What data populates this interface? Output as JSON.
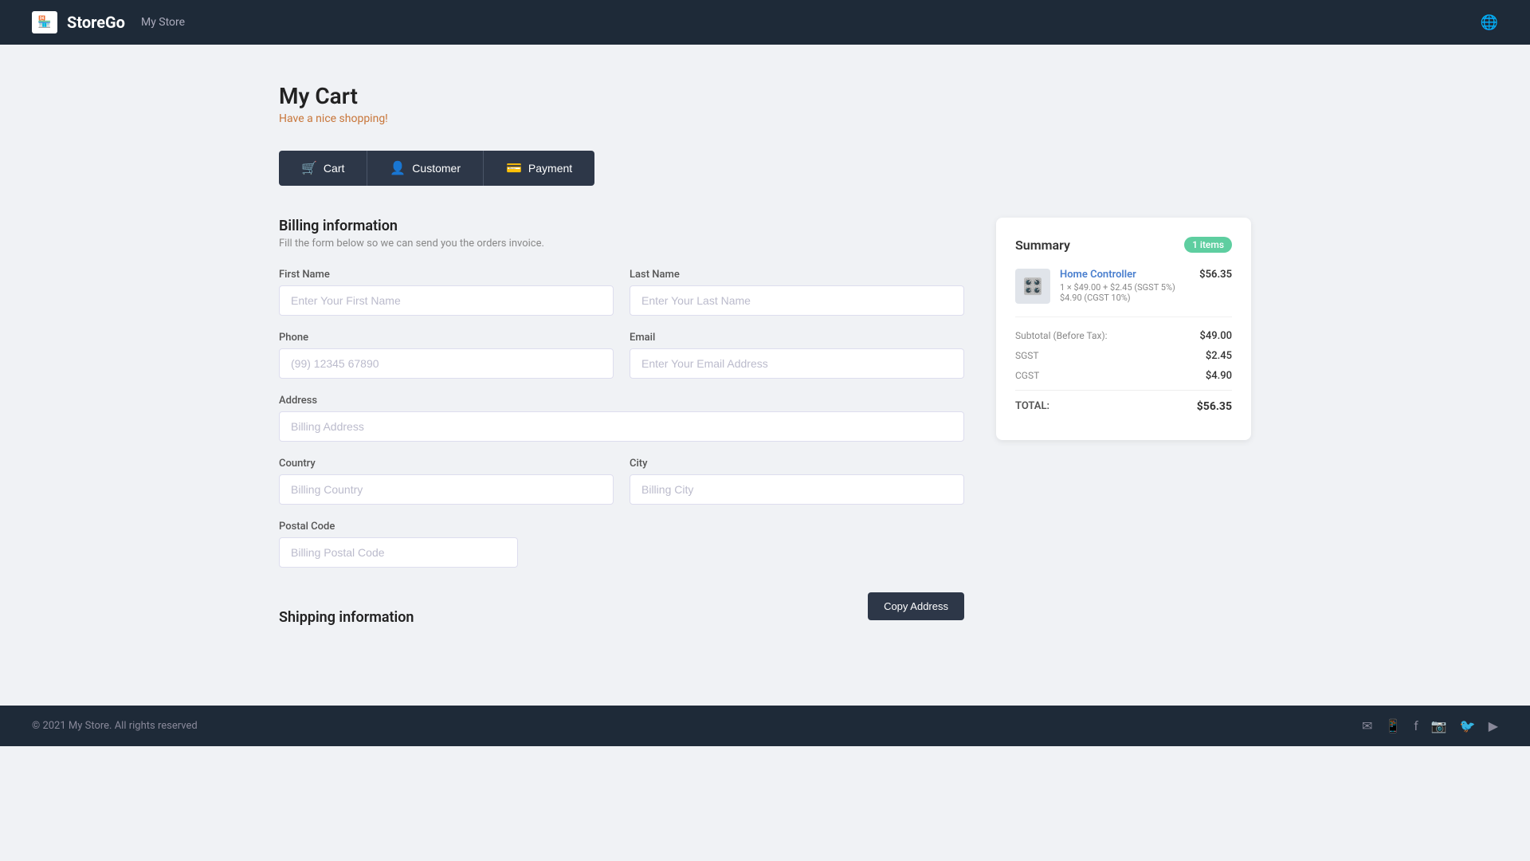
{
  "header": {
    "logo_text": "StoreGo",
    "store_name": "My Store",
    "logo_icon": "🏪"
  },
  "page": {
    "title": "My Cart",
    "subtitle": "Have a nice shopping!"
  },
  "tabs": [
    {
      "id": "cart",
      "label": "Cart",
      "icon": "🛒"
    },
    {
      "id": "customer",
      "label": "Customer",
      "icon": "👤"
    },
    {
      "id": "payment",
      "label": "Payment",
      "icon": "💳"
    }
  ],
  "billing": {
    "section_title": "Billing information",
    "section_subtitle": "Fill the form below so we can send you the orders invoice.",
    "fields": {
      "first_name_label": "First Name",
      "first_name_placeholder": "Enter Your First Name",
      "last_name_label": "Last Name",
      "last_name_placeholder": "Enter Your Last Name",
      "phone_label": "Phone",
      "phone_placeholder": "(99) 12345 67890",
      "email_label": "Email",
      "email_placeholder": "Enter Your Email Address",
      "address_label": "Address",
      "address_placeholder": "Billing Address",
      "country_label": "Country",
      "country_placeholder": "Billing Country",
      "city_label": "City",
      "city_placeholder": "Billing City",
      "postal_label": "Postal Code",
      "postal_placeholder": "Billing Postal Code"
    }
  },
  "shipping": {
    "section_title": "Shipping information",
    "copy_button_label": "Copy Address"
  },
  "summary": {
    "title": "Summary",
    "badge": "1 items",
    "item": {
      "name": "Home Controller",
      "desc_line1": "1 × $49.00 + $2.45 (SGST 5%)",
      "desc_line2": "$4.90 (CGST 10%)",
      "price": "$56.35"
    },
    "subtotal_label": "Subtotal (Before Tax):",
    "subtotal_value": "$49.00",
    "sgst_label": "SGST",
    "sgst_value": "$2.45",
    "cgst_label": "CGST",
    "cgst_value": "$4.90",
    "total_label": "TOTAL:",
    "total_value": "$56.35"
  },
  "footer": {
    "copyright": "© 2021 My Store. All rights reserved"
  }
}
